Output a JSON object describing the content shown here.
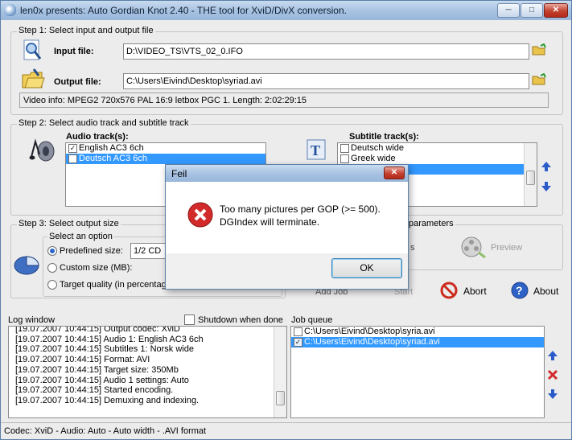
{
  "window": {
    "title": "len0x presents: Auto Gordian Knot 2.40 - THE tool for XviD/DivX conversion.",
    "minimize": "─",
    "maximize": "□",
    "close": "✕"
  },
  "step1": {
    "group": "Step 1: Select input and output file",
    "input_label": "Input file:",
    "input_value": "D:\\VIDEO_TS\\VTS_02_0.IFO",
    "output_label": "Output file:",
    "output_value": "C:\\Users\\Eivind\\Desktop\\syriad.avi",
    "video_info": "Video info: MPEG2 720x576 PAL 16:9 letbox  PGC 1. Length: 2:02:29:15"
  },
  "step2": {
    "group": "Step 2: Select audio track and subtitle track",
    "audio_label": "Audio track(s):",
    "audio_tracks": [
      {
        "label": "English AC3 6ch",
        "checked": true,
        "selected": false
      },
      {
        "label": "Deutsch AC3 6ch",
        "checked": false,
        "selected": true
      }
    ],
    "subtitle_label": "Subtitle track(s):",
    "subtitle_tracks": [
      {
        "label": "Deutsch wide",
        "checked": false,
        "selected": false
      },
      {
        "label": "Greek wide",
        "checked": false,
        "selected": false
      },
      {
        "label": "",
        "checked": false,
        "selected": true
      }
    ]
  },
  "step3": {
    "group": "Step 3: Select output size",
    "option_group": "Select an option",
    "predefined_label": "Predefined size:",
    "predefined_value": "1/2 CD",
    "custom_label": "Custom size (MB):",
    "target_label": "Target quality (in percentage"
  },
  "right_panel": {
    "parameters_label": "parameters",
    "s_fragment": "s",
    "preview_label": "Preview",
    "addjob_label": "Add Job",
    "start_label": "Start",
    "abort_label": "Abort",
    "about_label": "About"
  },
  "log": {
    "title": "Log window",
    "shutdown_label": "Shutdown when done",
    "lines": [
      "[19.07.2007 10:44:15] Output codec: XviD",
      "[19.07.2007 10:44:15] Audio 1: English AC3 6ch",
      "[19.07.2007 10:44:15] Subtitles 1: Norsk wide",
      "[19.07.2007 10:44:15] Format: AVI",
      "[19.07.2007 10:44:15] Target size: 350Mb",
      "[19.07.2007 10:44:15] Audio 1 settings: Auto",
      "[19.07.2007 10:44:15] Started encoding.",
      "[19.07.2007 10:44:15] Demuxing and indexing."
    ]
  },
  "queue": {
    "title": "Job queue",
    "items": [
      {
        "label": "C:\\Users\\Eivind\\Desktop\\syria.avi",
        "checked": false,
        "selected": false
      },
      {
        "label": "C:\\Users\\Eivind\\Desktop\\syriad.avi",
        "checked": true,
        "selected": true
      }
    ]
  },
  "status": {
    "text": "Codec: XviD -  Audio: Auto -  Auto width - .AVI format"
  },
  "dialog": {
    "title": "Feil",
    "close": "✕",
    "message_line1": "Too many pictures per GOP (>= 500).",
    "message_line2": "DGIndex will terminate.",
    "ok_label": "OK"
  },
  "colors": {
    "selection": "#3399ff",
    "arrow_blue": "#2a5bc9",
    "error_red": "#d22a2a"
  }
}
